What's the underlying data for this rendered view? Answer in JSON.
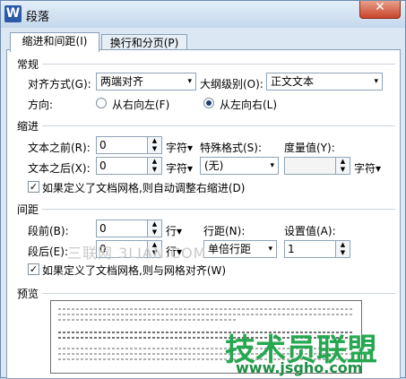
{
  "window": {
    "title": "段落",
    "app_icon_letter": "W",
    "close_glyph": "✕"
  },
  "tabs": [
    {
      "label": "缩进和间距(I)",
      "active": true
    },
    {
      "label": "换行和分页(P)",
      "active": false
    }
  ],
  "general": {
    "title": "常规",
    "alignment_label": "对齐方式(G):",
    "alignment_value": "两端对齐",
    "outline_label": "大纲级别(O):",
    "outline_value": "正文文本",
    "direction_label": "方向:",
    "rtl_label": "从右向左(F)",
    "ltr_label": "从左向右(L)",
    "direction_selected": "ltr"
  },
  "indent": {
    "title": "缩进",
    "before_label": "文本之前(R):",
    "before_value": "0",
    "before_unit": "字符",
    "after_label": "文本之后(X):",
    "after_value": "0",
    "after_unit": "字符",
    "special_label": "特殊格式(S):",
    "special_value": "(无)",
    "measure_label": "度量值(Y):",
    "measure_value": "",
    "measure_unit": "字符",
    "auto_adjust_label": "如果定义了文档网格,则自动调整右缩进(D)",
    "auto_adjust_checked": true
  },
  "spacing": {
    "title": "间距",
    "before_label": "段前(B):",
    "before_value": "0",
    "before_unit": "行",
    "after_label": "段后(E):",
    "after_value": "0",
    "after_unit": "行",
    "line_label": "行距(N):",
    "line_value": "单倍行距",
    "setting_label": "设置值(A):",
    "setting_value": "1",
    "grid_align_label": "如果定义了文档网格,则与网格对齐(W)",
    "grid_align_checked": true
  },
  "preview": {
    "title": "预览"
  },
  "watermarks": {
    "left": "三联网 3LIAN.COM",
    "right_big": "技术员联盟",
    "right_url": "www.jsgho.com"
  },
  "icons": {
    "dropdown": "▾",
    "spin_up": "▲",
    "spin_down": "▼",
    "check": "✓"
  }
}
